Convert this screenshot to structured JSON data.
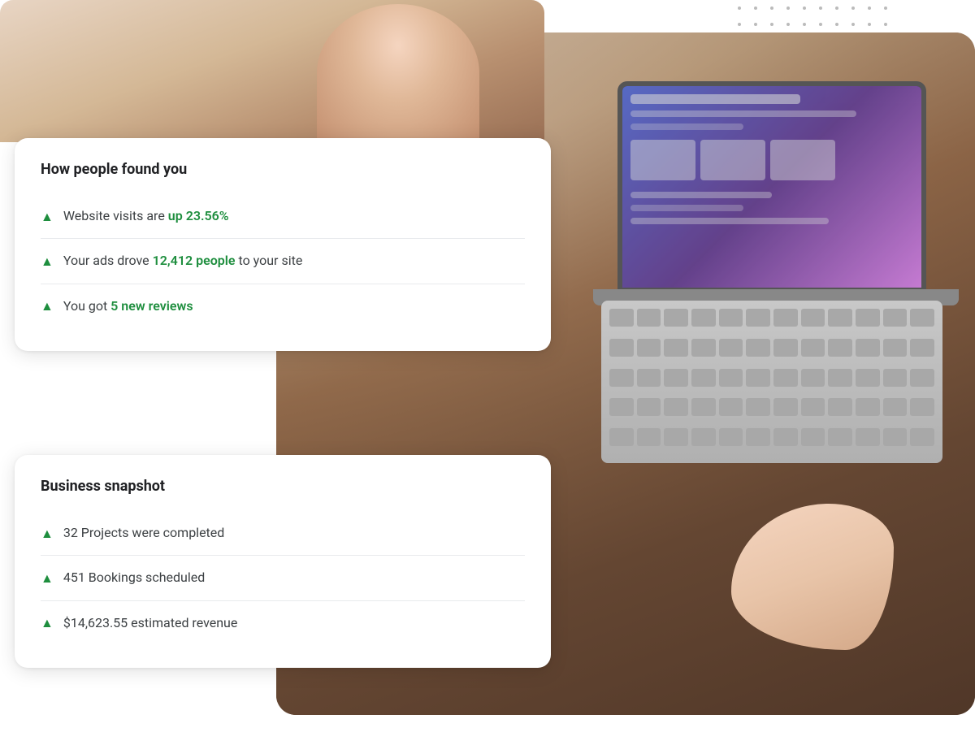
{
  "colors": {
    "green_highlight": "#1e8e3e",
    "card_bg": "#ffffff",
    "text_primary": "#202124",
    "text_secondary": "#3c4043",
    "divider": "#e8eaed",
    "shadow": "rgba(0,0,0,0.12)"
  },
  "top_card": {
    "title": "How people found you",
    "items": [
      {
        "id": "website-visits",
        "text_before": "Website visits are ",
        "highlight": "up 23.56%",
        "text_after": ""
      },
      {
        "id": "ads-drove",
        "text_before": "Your ads drove ",
        "highlight": "12,412 people",
        "text_after": " to your site"
      },
      {
        "id": "new-reviews",
        "text_before": "You got ",
        "highlight": "5 new reviews",
        "text_after": ""
      }
    ]
  },
  "bottom_card": {
    "title": "Business snapshot",
    "items": [
      {
        "id": "projects-completed",
        "text_before": "32 Projects were completed",
        "highlight": "",
        "text_after": ""
      },
      {
        "id": "bookings-scheduled",
        "text_before": "451 Bookings scheduled",
        "highlight": "",
        "text_after": ""
      },
      {
        "id": "estimated-revenue",
        "text_before": "$14,623.55 estimated revenue",
        "highlight": "",
        "text_after": ""
      }
    ]
  }
}
